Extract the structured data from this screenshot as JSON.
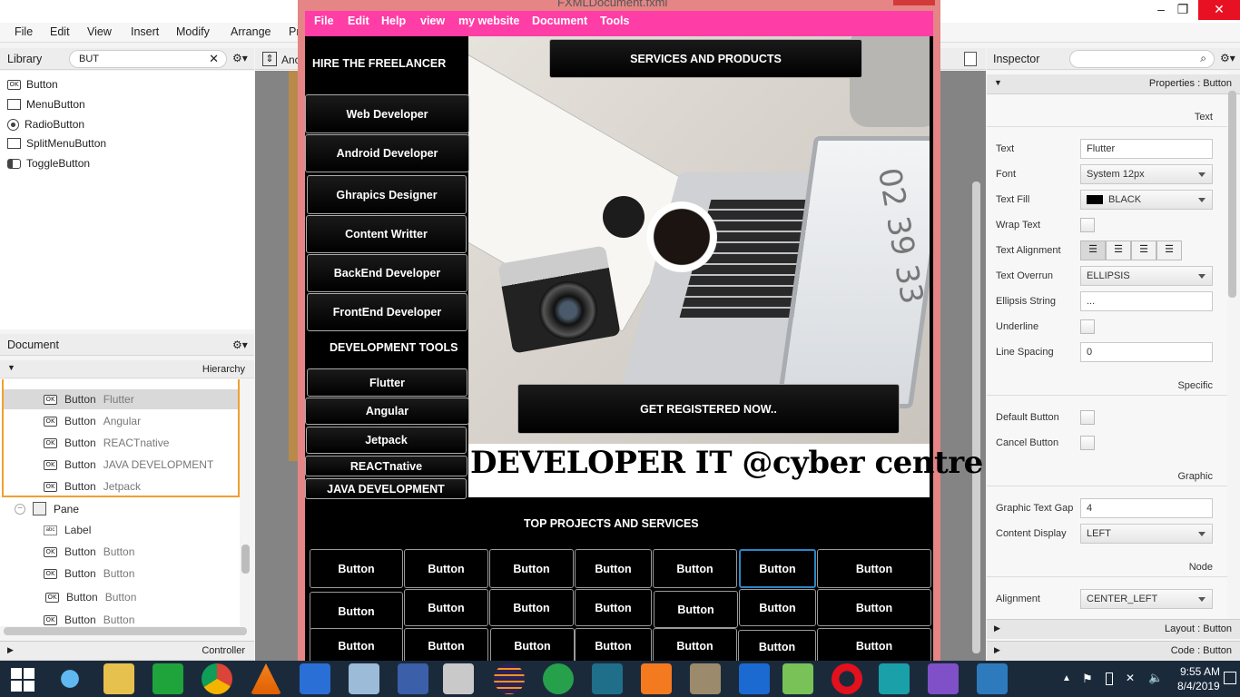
{
  "app": {
    "window_title": "FXMLDocument.fxml"
  },
  "menubar": [
    "File",
    "Edit",
    "View",
    "Insert",
    "Modify",
    "Arrange",
    "Pr"
  ],
  "win_controls": {
    "min": "–",
    "max": "❐",
    "close": "✕"
  },
  "library": {
    "title": "Library",
    "search_value": "BUT",
    "items": [
      "Button",
      "MenuButton",
      "RadioButton",
      "SplitMenuButton",
      "ToggleButton"
    ]
  },
  "document": {
    "title": "Document",
    "hierarchy_label": "Hierarchy",
    "rows": [
      {
        "type": "Button",
        "value": "Flutter"
      },
      {
        "type": "Button",
        "value": "Angular"
      },
      {
        "type": "Button",
        "value": "REACTnative"
      },
      {
        "type": "Button",
        "value": "JAVA DEVELOPMENT"
      },
      {
        "type": "Button",
        "value": "Jetpack"
      }
    ],
    "pane_label": "Pane",
    "label_label": "Label",
    "button_rows": [
      {
        "type": "Button",
        "value": "Button"
      },
      {
        "type": "Button",
        "value": "Button"
      },
      {
        "type": "Button",
        "value": "Button"
      },
      {
        "type": "Button",
        "value": "Button"
      }
    ],
    "controller_label": "Controller"
  },
  "center_tab": "Anc",
  "fx": {
    "menu": [
      "File",
      "Edit",
      "Help",
      "view",
      "my website",
      "Document",
      "Tools"
    ],
    "hire": "HIRE THE FREELANCER",
    "services_button": "SERVICES AND PRODUCTS",
    "left_buttons": [
      "Web Developer",
      "Android Developer",
      "Ghrapics Designer",
      "Content Writter",
      "BackEnd Developer",
      "FrontEnd Developer"
    ],
    "dev_tools": "DEVELOPMENT TOOLS",
    "tool_buttons": [
      "Flutter",
      "Angular",
      "Jetpack",
      "REACTnative",
      "JAVA DEVELOPMENT"
    ],
    "register_button": "GET REGISTERED NOW..",
    "headline": "DEVELOPER IT @cyber centre",
    "top_projects": "TOP PROJECTS AND SERVICES",
    "grid_button_label": "Button",
    "laptop_screen_text": "02 39 33"
  },
  "inspector": {
    "title": "Inspector",
    "properties_header": "Properties : Button",
    "text_section": "Text",
    "fields": {
      "text_label": "Text",
      "text_value": "Flutter",
      "font_label": "Font",
      "font_value": "System 12px",
      "fill_label": "Text Fill",
      "fill_value": "BLACK",
      "wrap_label": "Wrap Text",
      "align_label": "Text Alignment",
      "overrun_label": "Text Overrun",
      "overrun_value": "ELLIPSIS",
      "ellipsis_label": "Ellipsis String",
      "ellipsis_value": "...",
      "underline_label": "Underline",
      "spacing_label": "Line Spacing",
      "spacing_value": "0"
    },
    "specific_section": "Specific",
    "default_label": "Default Button",
    "cancel_label": "Cancel Button",
    "graphic_section": "Graphic",
    "gap_label": "Graphic Text Gap",
    "gap_value": "4",
    "display_label": "Content Display",
    "display_value": "LEFT",
    "node_section": "Node",
    "alignment_label": "Alignment",
    "alignment_value": "CENTER_LEFT",
    "layout_header": "Layout : Button",
    "code_header": "Code : Button"
  },
  "taskbar": {
    "time": "9:55 AM",
    "date": "8/4/2019"
  },
  "colors": {
    "fx_menu": "#ff3da6",
    "fx_frame": "#e58585",
    "selected_tree": "#d9d9d9",
    "orange_border": "#f0a030"
  }
}
